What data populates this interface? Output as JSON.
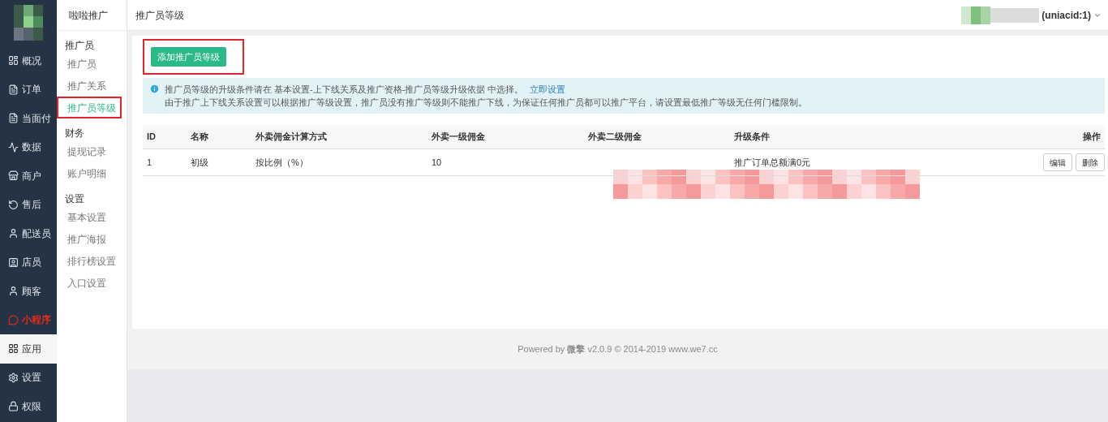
{
  "sidebar": {
    "items": [
      {
        "label": "概况",
        "selected": false,
        "kind": "link"
      },
      {
        "label": "订单",
        "selected": false,
        "kind": "link"
      },
      {
        "label": "当面付",
        "selected": false,
        "kind": "link"
      },
      {
        "label": "数据",
        "selected": false,
        "kind": "link"
      },
      {
        "label": "商户",
        "selected": false,
        "kind": "link"
      },
      {
        "label": "售后",
        "selected": false,
        "kind": "link"
      },
      {
        "label": "配送员",
        "selected": false,
        "kind": "link"
      },
      {
        "label": "店员",
        "selected": false,
        "kind": "link"
      },
      {
        "label": "顾客",
        "selected": false,
        "kind": "link"
      },
      {
        "label": "小程序",
        "selected": false,
        "kind": "promo"
      },
      {
        "label": "应用",
        "selected": true,
        "kind": "link"
      },
      {
        "label": "设置",
        "selected": false,
        "kind": "link"
      },
      {
        "label": "权限",
        "selected": false,
        "kind": "link"
      }
    ]
  },
  "submenu": {
    "title": "啦啦推广",
    "groups": [
      {
        "title": "推广员",
        "items": [
          {
            "label": "推广员",
            "selected": false,
            "highlighted": false
          },
          {
            "label": "推广关系",
            "selected": false,
            "highlighted": false
          },
          {
            "label": "推广员等级",
            "selected": true,
            "highlighted": true
          }
        ]
      },
      {
        "title": "财务",
        "items": [
          {
            "label": "提现记录",
            "selected": false,
            "highlighted": false
          },
          {
            "label": "账户明细",
            "selected": false,
            "highlighted": false
          }
        ]
      },
      {
        "title": "设置",
        "items": [
          {
            "label": "基本设置",
            "selected": false,
            "highlighted": false
          },
          {
            "label": "推广海报",
            "selected": false,
            "highlighted": false
          },
          {
            "label": "排行榜设置",
            "selected": false,
            "highlighted": false
          },
          {
            "label": "入口设置",
            "selected": false,
            "highlighted": false
          }
        ]
      }
    ]
  },
  "header": {
    "title": "推广员等级",
    "account": "(uniacid:1)"
  },
  "add_button": {
    "label": "添加推广员等级",
    "highlighted": true
  },
  "notice": {
    "line_1": "推广员等级的升级条件请在 基本设置-上下线关系及推广资格-推广员等级升级依据 中选择。",
    "link": "立即设置",
    "line_2": "由于推广上下线关系设置可以根据推广等级设置，推广员没有推广等级则不能推广下线，为保证任何推广员都可以推广平台，请设置最低推广等级无任何门槛限制。"
  },
  "table": {
    "columns": [
      "ID",
      "名称",
      "外卖佣金计算方式",
      "外卖一级佣金",
      "外卖二级佣金",
      "升级条件",
      "操作"
    ],
    "rows": [
      {
        "cells": [
          "1",
          "初级",
          "按比例（%）",
          "10",
          "",
          "推广订单总额满0元"
        ],
        "actions": [
          "编辑",
          "删除"
        ]
      }
    ]
  },
  "footer": "Powered by **微擎** v2.0.9 © 2014-2019 www.we7.cc"
}
